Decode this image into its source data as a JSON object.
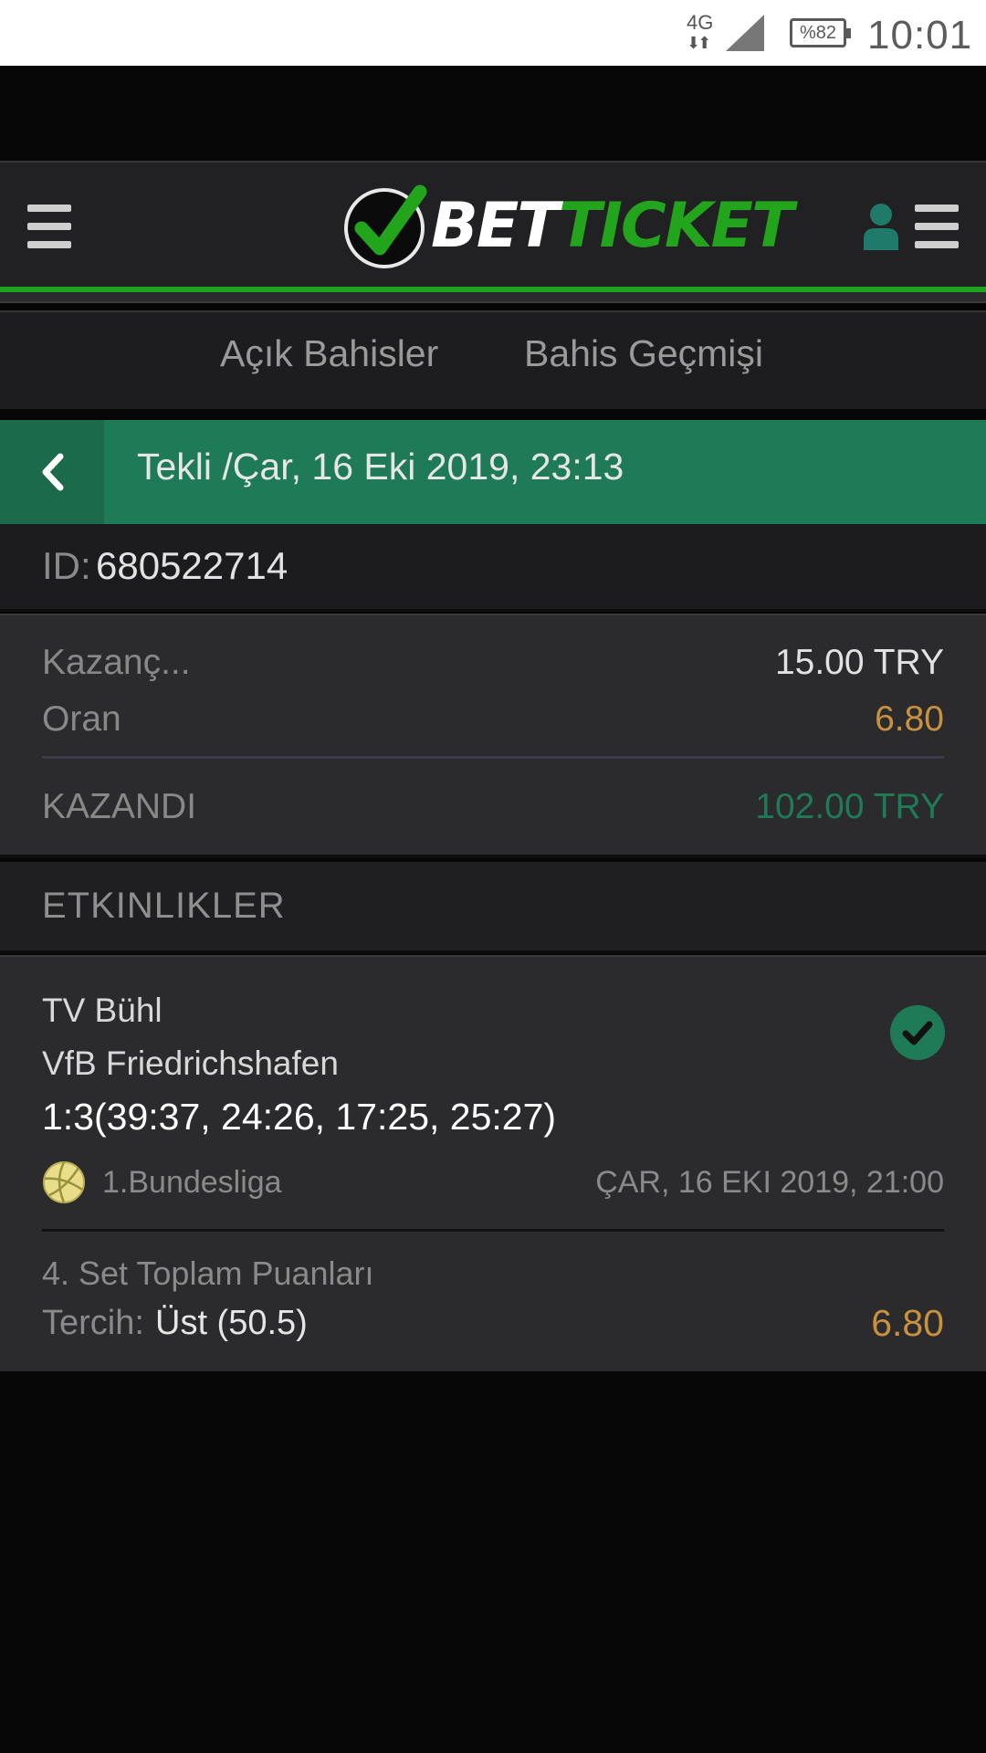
{
  "status_bar": {
    "network": "4G",
    "battery": "%82",
    "time": "10:01"
  },
  "app": {
    "logo_part1": "BET",
    "logo_part2": "TICKET"
  },
  "tabs": [
    {
      "label": "Açık Bahisler"
    },
    {
      "label": "Bahis Geçmişi"
    }
  ],
  "bet_header": {
    "title": "Tekli /Çar, 16 Eki 2019, 23:13"
  },
  "bet": {
    "id_label": "ID:",
    "id_value": "680522714",
    "stake_label": "Kazanç...",
    "stake_value": "15.00 TRY",
    "odds_label": "Oran",
    "odds_value": "6.80",
    "result_label": "KAZANDI",
    "result_value": "102.00 TRY"
  },
  "events_section": {
    "title": "ETKINLIKLER"
  },
  "event": {
    "home_team": "TV Bühl",
    "away_team": "VfB Friedrichshafen",
    "score": "1:3(39:37, 24:26, 17:25, 25:27)",
    "league": "1.Bundesliga",
    "date": "ÇAR, 16 EKI 2019, 21:00",
    "market": "4. Set Toplam Puanları",
    "preference_label": "Tercih:",
    "preference_value": "Üst (50.5)",
    "preference_odds": "6.80",
    "status": "won"
  },
  "colors": {
    "brand_green": "#23a41d",
    "header_green": "#1f7a57",
    "odds_orange": "#c9903f",
    "win_green": "#1f7a57"
  }
}
